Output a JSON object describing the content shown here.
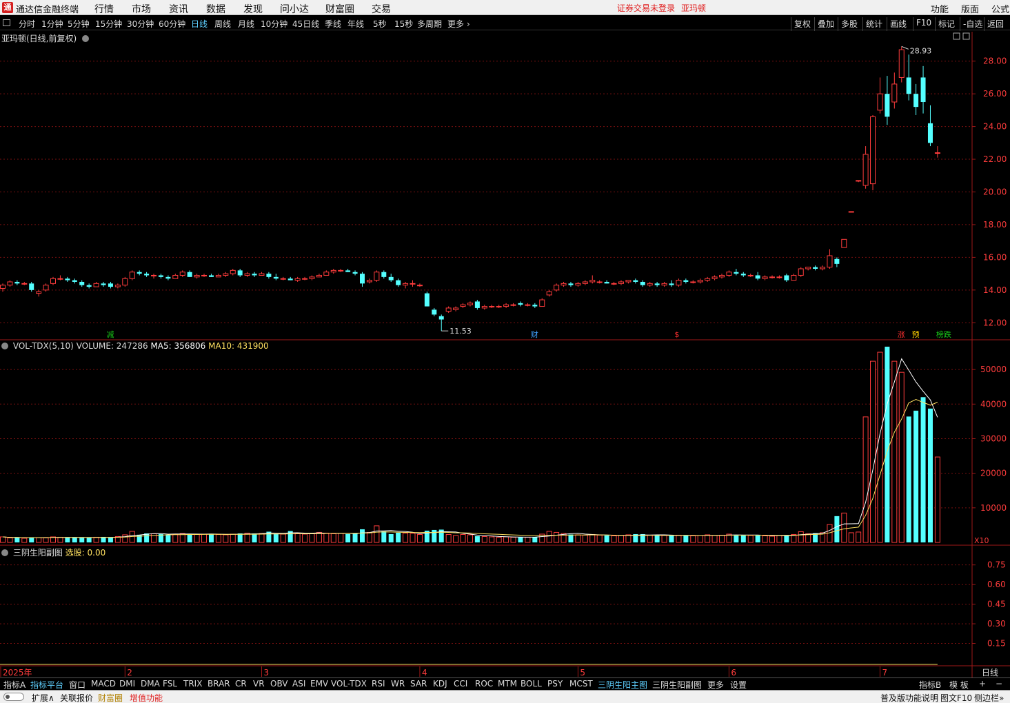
{
  "app": {
    "title": "通达信金融终端",
    "logo_glyph": "通",
    "login_status": "证券交易未登录",
    "stock_name": "亚玛顿"
  },
  "menu": [
    "行情",
    "市场",
    "资讯",
    "数据",
    "发现",
    "问小达",
    "财富圈",
    "交易"
  ],
  "right_menu": [
    "功能",
    "版面",
    "公式"
  ],
  "periods": [
    "分时",
    "1分钟",
    "5分钟",
    "15分钟",
    "30分钟",
    "60分钟",
    "日线",
    "周线",
    "月线",
    "10分钟",
    "45日线",
    "季线",
    "年线",
    "5秒",
    "15秒",
    "多周期",
    "更多 ›"
  ],
  "active_period": "日线",
  "right_tools": [
    "复权",
    "叠加",
    "多股",
    "统计",
    "画线",
    "F10",
    "标记",
    "-自选",
    "返回"
  ],
  "main_chart": {
    "title": "亚玛顿(日线,前复权)",
    "price_axis": [
      "28.00",
      "26.00",
      "24.00",
      "22.00",
      "20.00",
      "18.00",
      "16.00",
      "14.00",
      "12.00"
    ],
    "high_label": "28.93",
    "low_label": "11.53",
    "markers": [
      {
        "text": "减",
        "color": "#19c819"
      },
      {
        "text": "财",
        "color": "#3fa0ff"
      },
      {
        "text": "$",
        "color": "#ff3030"
      },
      {
        "text": "涨",
        "color": "#ff3030"
      },
      {
        "text": "预",
        "color": "#ffd000"
      },
      {
        "text": "榜跌",
        "color": "#19c819"
      }
    ]
  },
  "volume_chart": {
    "indicator": "VOL-TDX(5,10)",
    "volume_label": "VOLUME: 247286",
    "ma5_label": "MA5: 356806",
    "ma10_label": "MA10: 431900",
    "axis": [
      "50000",
      "40000",
      "30000",
      "20000",
      "10000"
    ],
    "unit": "X10"
  },
  "sub_chart": {
    "title": "三阴生阳副图",
    "select_label": "选股: 0.00",
    "axis": [
      "0.75",
      "0.60",
      "0.45",
      "0.30",
      "0.15"
    ]
  },
  "date_axis": {
    "labels": [
      "2025年",
      "2",
      "3",
      "4",
      "5",
      "6",
      "7"
    ],
    "period_label": "日线"
  },
  "indicator_tabs": [
    "指标A",
    "指标平台",
    "窗口",
    "MACD",
    "DMI",
    "DMA",
    "FSL",
    "TRIX",
    "BRAR",
    "CR",
    "VR",
    "OBV",
    "ASI",
    "EMV",
    "VOL-TDX",
    "RSI",
    "WR",
    "SAR",
    "KDJ",
    "CCI",
    "ROC",
    "MTM",
    "BOLL",
    "PSY",
    "MCST",
    "三阴生阳主图",
    "三阴生阳副图",
    "更多",
    "设置"
  ],
  "indicator_right": [
    "指标B",
    "模 板",
    "+",
    "−"
  ],
  "status_bar": {
    "left": [
      "扩展∧",
      "关联报价",
      "财富圈",
      "增值功能"
    ],
    "right": [
      "普及版功能说明",
      "图文F10",
      "侧边栏»"
    ]
  },
  "chart_data": [
    {
      "type": "candlestick",
      "title": "亚玛顿(日线,前复权)",
      "ylim": [
        11.0,
        29.8
      ],
      "ohlc": [
        [
          14.1,
          14.4,
          13.9,
          14.3
        ],
        [
          14.3,
          14.6,
          14.2,
          14.5
        ],
        [
          14.5,
          14.6,
          14.3,
          14.4
        ],
        [
          14.4,
          14.5,
          14.3,
          14.4
        ],
        [
          14.4,
          14.5,
          13.9,
          14.0
        ],
        [
          13.8,
          14.0,
          13.6,
          13.9
        ],
        [
          14.0,
          14.4,
          13.9,
          14.3
        ],
        [
          14.4,
          14.8,
          14.3,
          14.7
        ],
        [
          14.7,
          14.9,
          14.6,
          14.7
        ],
        [
          14.7,
          14.8,
          14.5,
          14.6
        ],
        [
          14.6,
          14.7,
          14.4,
          14.5
        ],
        [
          14.5,
          14.6,
          14.2,
          14.3
        ],
        [
          14.3,
          14.4,
          14.1,
          14.2
        ],
        [
          14.2,
          14.5,
          14.2,
          14.4
        ],
        [
          14.4,
          14.5,
          14.2,
          14.3
        ],
        [
          14.4,
          14.5,
          14.1,
          14.2
        ],
        [
          14.2,
          14.4,
          14.1,
          14.3
        ],
        [
          14.3,
          14.8,
          14.2,
          14.7
        ],
        [
          14.7,
          15.2,
          14.6,
          15.1
        ],
        [
          15.1,
          15.2,
          14.9,
          15.0
        ],
        [
          15.0,
          15.1,
          14.8,
          14.9
        ],
        [
          14.9,
          15.0,
          14.7,
          14.9
        ],
        [
          14.9,
          15.0,
          14.7,
          14.8
        ],
        [
          14.8,
          14.9,
          14.6,
          14.7
        ],
        [
          14.7,
          15.0,
          14.7,
          14.9
        ],
        [
          14.9,
          15.2,
          14.8,
          15.1
        ],
        [
          15.1,
          15.2,
          14.8,
          14.8
        ],
        [
          14.8,
          15.0,
          14.7,
          14.9
        ],
        [
          14.9,
          15.0,
          14.8,
          14.9
        ],
        [
          14.9,
          15.0,
          14.8,
          14.8
        ],
        [
          14.8,
          15.0,
          14.8,
          14.9
        ],
        [
          14.9,
          15.1,
          14.8,
          15.0
        ],
        [
          15.0,
          15.3,
          14.9,
          15.2
        ],
        [
          15.2,
          15.3,
          14.8,
          14.9
        ],
        [
          14.9,
          15.1,
          14.8,
          15.0
        ],
        [
          15.0,
          15.1,
          14.8,
          14.9
        ],
        [
          14.9,
          15.1,
          14.9,
          15.0
        ],
        [
          15.0,
          15.1,
          14.7,
          14.8
        ],
        [
          14.8,
          15.0,
          14.6,
          14.7
        ],
        [
          14.7,
          14.8,
          14.6,
          14.7
        ],
        [
          14.7,
          14.8,
          14.6,
          14.6
        ],
        [
          14.6,
          14.8,
          14.5,
          14.7
        ],
        [
          14.7,
          14.8,
          14.6,
          14.7
        ],
        [
          14.7,
          14.9,
          14.6,
          14.8
        ],
        [
          14.8,
          15.0,
          14.8,
          14.9
        ],
        [
          14.9,
          15.2,
          14.9,
          15.1
        ],
        [
          15.1,
          15.3,
          15.0,
          15.2
        ],
        [
          15.2,
          15.3,
          15.1,
          15.2
        ],
        [
          15.2,
          15.3,
          15.1,
          15.1
        ],
        [
          15.1,
          15.2,
          14.9,
          15.0
        ],
        [
          15.0,
          15.1,
          14.2,
          14.4
        ],
        [
          14.5,
          14.7,
          14.4,
          14.6
        ],
        [
          14.6,
          15.2,
          14.5,
          15.1
        ],
        [
          15.1,
          15.2,
          14.7,
          14.8
        ],
        [
          14.8,
          15.0,
          14.5,
          14.6
        ],
        [
          14.6,
          14.7,
          14.2,
          14.3
        ],
        [
          14.3,
          14.5,
          14.1,
          14.4
        ],
        [
          14.4,
          14.6,
          14.2,
          14.4
        ],
        [
          14.3,
          14.4,
          14.2,
          14.3
        ],
        [
          13.8,
          13.9,
          13.0,
          13.0
        ],
        [
          12.8,
          12.9,
          12.4,
          12.5
        ],
        [
          12.4,
          12.5,
          11.5,
          12.2
        ],
        [
          12.7,
          13.0,
          12.6,
          12.9
        ],
        [
          12.8,
          13.0,
          12.7,
          12.9
        ],
        [
          13.0,
          13.2,
          12.9,
          13.1
        ],
        [
          13.1,
          13.3,
          13.0,
          13.2
        ],
        [
          13.3,
          13.4,
          12.8,
          12.9
        ],
        [
          12.9,
          13.1,
          12.8,
          13.0
        ],
        [
          13.0,
          13.1,
          12.9,
          13.0
        ],
        [
          13.0,
          13.1,
          12.9,
          13.0
        ],
        [
          13.0,
          13.2,
          12.9,
          13.1
        ],
        [
          13.1,
          13.2,
          13.0,
          13.1
        ],
        [
          13.2,
          13.3,
          13.0,
          13.1
        ],
        [
          13.1,
          13.2,
          13.0,
          13.1
        ],
        [
          13.1,
          13.2,
          12.9,
          13.0
        ],
        [
          13.0,
          13.5,
          13.0,
          13.4
        ],
        [
          13.7,
          14.0,
          13.6,
          13.9
        ],
        [
          14.0,
          14.4,
          13.9,
          14.3
        ],
        [
          14.3,
          14.5,
          14.2,
          14.4
        ],
        [
          14.4,
          14.5,
          14.2,
          14.3
        ],
        [
          14.3,
          14.5,
          14.2,
          14.4
        ],
        [
          14.4,
          14.6,
          14.3,
          14.5
        ],
        [
          14.5,
          14.9,
          14.4,
          14.6
        ],
        [
          14.5,
          14.6,
          14.4,
          14.5
        ],
        [
          14.5,
          14.6,
          14.4,
          14.4
        ],
        [
          14.4,
          14.5,
          14.3,
          14.4
        ],
        [
          14.4,
          14.6,
          14.3,
          14.5
        ],
        [
          14.5,
          14.6,
          14.4,
          14.6
        ],
        [
          14.6,
          14.7,
          14.4,
          14.5
        ],
        [
          14.5,
          14.6,
          14.2,
          14.3
        ],
        [
          14.3,
          14.5,
          14.2,
          14.4
        ],
        [
          14.4,
          14.5,
          14.2,
          14.3
        ],
        [
          14.3,
          14.5,
          14.2,
          14.4
        ],
        [
          14.4,
          14.6,
          14.2,
          14.3
        ],
        [
          14.3,
          14.7,
          14.2,
          14.6
        ],
        [
          14.6,
          14.7,
          14.4,
          14.5
        ],
        [
          14.5,
          14.6,
          14.4,
          14.5
        ],
        [
          14.5,
          14.7,
          14.4,
          14.6
        ],
        [
          14.6,
          14.8,
          14.5,
          14.7
        ],
        [
          14.7,
          14.9,
          14.6,
          14.8
        ],
        [
          14.8,
          15.0,
          14.7,
          14.9
        ],
        [
          14.9,
          15.2,
          14.8,
          15.1
        ],
        [
          15.1,
          15.3,
          14.9,
          15.0
        ],
        [
          15.0,
          15.1,
          14.8,
          14.9
        ],
        [
          14.9,
          15.0,
          14.8,
          14.9
        ],
        [
          14.9,
          15.1,
          14.6,
          14.7
        ],
        [
          14.7,
          14.9,
          14.6,
          14.8
        ],
        [
          14.8,
          14.9,
          14.7,
          14.8
        ],
        [
          14.8,
          14.9,
          14.7,
          14.8
        ],
        [
          14.9,
          15.0,
          14.5,
          14.6
        ],
        [
          14.6,
          15.0,
          14.6,
          14.9
        ],
        [
          14.9,
          15.4,
          14.8,
          15.3
        ],
        [
          15.3,
          15.4,
          15.2,
          15.4
        ],
        [
          15.4,
          15.5,
          15.2,
          15.3
        ],
        [
          15.3,
          15.5,
          15.2,
          15.4
        ],
        [
          15.4,
          16.5,
          15.3,
          16.1
        ],
        [
          15.9,
          16.0,
          15.4,
          15.6
        ],
        [
          16.6,
          17.1,
          16.6,
          17.1
        ],
        [
          18.8,
          18.8,
          18.8,
          18.8
        ],
        [
          20.7,
          20.7,
          20.6,
          20.7
        ],
        [
          20.4,
          22.8,
          20.2,
          22.3
        ],
        [
          20.5,
          24.7,
          20.1,
          24.6
        ],
        [
          25.0,
          27.0,
          24.8,
          26.0
        ],
        [
          26.0,
          27.1,
          24.1,
          24.6
        ],
        [
          25.5,
          27.3,
          25.1,
          26.6
        ],
        [
          27.0,
          28.9,
          26.7,
          28.7
        ],
        [
          27.0,
          28.4,
          25.6,
          26.0
        ],
        [
          26.0,
          26.6,
          24.7,
          25.2
        ],
        [
          27.0,
          27.7,
          24.8,
          25.5
        ],
        [
          24.2,
          25.3,
          22.8,
          23.0
        ],
        [
          22.4,
          22.8,
          22.1,
          22.4
        ]
      ]
    },
    {
      "type": "bar",
      "title": "VOL-TDX(5,10)",
      "ylim": [
        0,
        58000
      ],
      "values": [
        1600,
        1300,
        1400,
        1200,
        1500,
        1400,
        1300,
        1600,
        1500,
        1400,
        1500,
        1300,
        1400,
        1500,
        1600,
        1400,
        1700,
        2200,
        3200,
        2200,
        2600,
        2500,
        2400,
        2300,
        2400,
        2600,
        2500,
        2300,
        2400,
        2500,
        2300,
        2200,
        2400,
        2600,
        2700,
        2600,
        2600,
        3100,
        2500,
        2400,
        3300,
        2700,
        2400,
        2600,
        2900,
        2700,
        2500,
        2600,
        2400,
        2600,
        3800,
        2900,
        4800,
        3200,
        2400,
        2800,
        2700,
        2600,
        2300,
        3400,
        3600,
        3700,
        2300,
        2000,
        2300,
        2200,
        1800,
        1700,
        1600,
        1500,
        1600,
        1500,
        1500,
        1500,
        1500,
        2400,
        3200,
        2900,
        2600,
        2300,
        2200,
        2100,
        2300,
        2100,
        2000,
        1900,
        2000,
        2200,
        2400,
        2400,
        2100,
        2100,
        2000,
        2000,
        2100,
        2000,
        1900,
        2000,
        2200,
        2000,
        2100,
        2400,
        2200,
        2100,
        2000,
        2100,
        1900,
        1800,
        2000,
        2000,
        2300,
        3100,
        2500,
        2700,
        2800,
        5200,
        7600,
        8500,
        2800,
        3000,
        36300,
        52400,
        55000,
        56600,
        52400,
        49200,
        36400,
        38100,
        42000,
        38700,
        24700
      ],
      "ma5": [
        1600,
        1450,
        1430,
        1370,
        1400,
        1380,
        1360,
        1440,
        1460,
        1440,
        1460,
        1460,
        1420,
        1420,
        1460,
        1440,
        1520,
        1680,
        2020,
        2140,
        2380,
        2540,
        2580,
        2400,
        2440,
        2440,
        2460,
        2420,
        2400,
        2460,
        2400,
        2340,
        2360,
        2400,
        2440,
        2480,
        2560,
        2720,
        2700,
        2640,
        2780,
        2800,
        2700,
        2680,
        2780,
        2660,
        2620,
        2620,
        2620,
        2560,
        2780,
        2860,
        3300,
        3340,
        3420,
        3220,
        3160,
        2940,
        2560,
        2760,
        2880,
        3120,
        3060,
        3000,
        2660,
        2420,
        2120,
        2000,
        1880,
        1720,
        1640,
        1580,
        1540,
        1520,
        1520,
        1700,
        1860,
        2100,
        2320,
        2560,
        2640,
        2420,
        2300,
        2200,
        2140,
        2080,
        2060,
        2060,
        2100,
        2180,
        2160,
        2200,
        2200,
        2120,
        2060,
        2040,
        2020,
        2000,
        2040,
        2040,
        2040,
        2140,
        2180,
        2160,
        2160,
        2160,
        2060,
        1980,
        1980,
        1960,
        2000,
        2240,
        2380,
        2520,
        2680,
        3460,
        4560,
        5360,
        5380,
        5420,
        11620,
        20940,
        31500,
        40100,
        46400,
        53100,
        49800,
        46400,
        43700,
        41200,
        36200
      ],
      "ma10": [
        1600,
        1450,
        1430,
        1375,
        1400,
        1400,
        1390,
        1410,
        1430,
        1430,
        1430,
        1420,
        1420,
        1430,
        1440,
        1440,
        1470,
        1540,
        1710,
        1790,
        1900,
        2020,
        2120,
        2200,
        2230,
        2250,
        2290,
        2300,
        2320,
        2330,
        2330,
        2320,
        2330,
        2340,
        2350,
        2370,
        2390,
        2450,
        2460,
        2450,
        2480,
        2490,
        2500,
        2500,
        2530,
        2600,
        2610,
        2660,
        2660,
        2650,
        2720,
        2740,
        2960,
        3020,
        3010,
        2920,
        2900,
        2880,
        2860,
        2900,
        2870,
        2940,
        2890,
        2780,
        2780,
        2720,
        2600,
        2500,
        2420,
        2350,
        2260,
        2180,
        2100,
        2050,
        2000,
        2030,
        2050,
        2080,
        2100,
        2120,
        2170,
        2160,
        2190,
        2180,
        2150,
        2100,
        2030,
        2010,
        2020,
        2020,
        2030,
        2030,
        2020,
        2010,
        2020,
        2030,
        2010,
        2010,
        2020,
        2020,
        2030,
        2080,
        2100,
        2100,
        2100,
        2100,
        2100,
        2080,
        2060,
        2070,
        2070,
        2160,
        2240,
        2320,
        2400,
        2800,
        3380,
        3920,
        4180,
        4410,
        7830,
        12710,
        19600,
        26360,
        31870,
        35700,
        40370,
        41360,
        40480,
        39690,
        40560
      ],
      "unit": "X10"
    }
  ]
}
